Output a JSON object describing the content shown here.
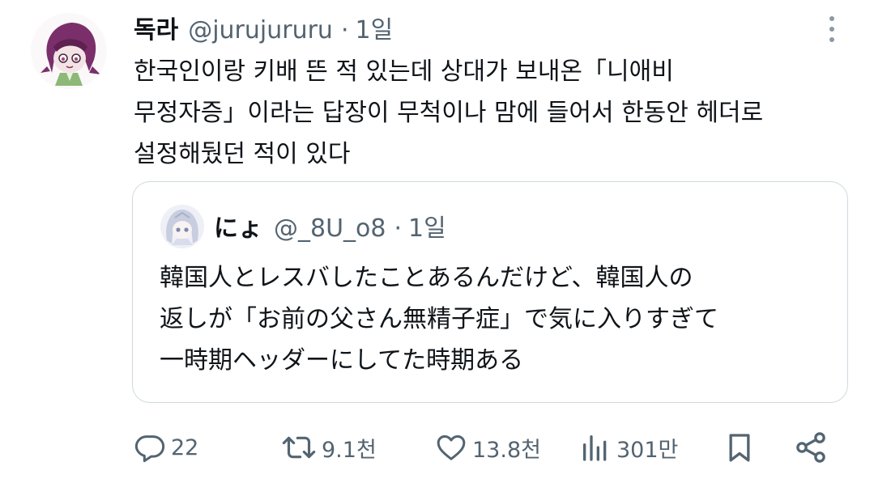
{
  "tweet": {
    "author": {
      "display_name": "독라",
      "handle": "@jurujururu",
      "time": "1일"
    },
    "separator": "·",
    "text_lines": [
      "한국인이랑 키배 뜬 적 있는데 상대가 보내온「니애비",
      "무정자증」이라는 답장이 무척이나 맘에 들어서 한동안 헤더로",
      "설정해뒀던 적이 있다"
    ]
  },
  "quote": {
    "author": {
      "display_name": "にょ",
      "handle": "@_8U_o8",
      "time": "1일"
    },
    "separator": "·",
    "text_lines": [
      "韓国人とレスバしたことあるんだけど、韓国人の",
      "返しが「お前の父さん無精子症」で気に入りすぎて",
      "一時期ヘッダーにしてた時期ある"
    ]
  },
  "actions": {
    "reply": {
      "icon": "reply-icon",
      "count": "22"
    },
    "retweet": {
      "icon": "retweet-icon",
      "count": "9.1천"
    },
    "like": {
      "icon": "heart-icon",
      "count": "13.8천"
    },
    "views": {
      "icon": "bar-chart-icon",
      "count": "301만"
    },
    "bookmark": {
      "icon": "bookmark-icon"
    },
    "share": {
      "icon": "share-icon"
    }
  },
  "colors": {
    "text_primary": "#0f1419",
    "text_secondary": "#536471",
    "border": "#cfd9de"
  }
}
